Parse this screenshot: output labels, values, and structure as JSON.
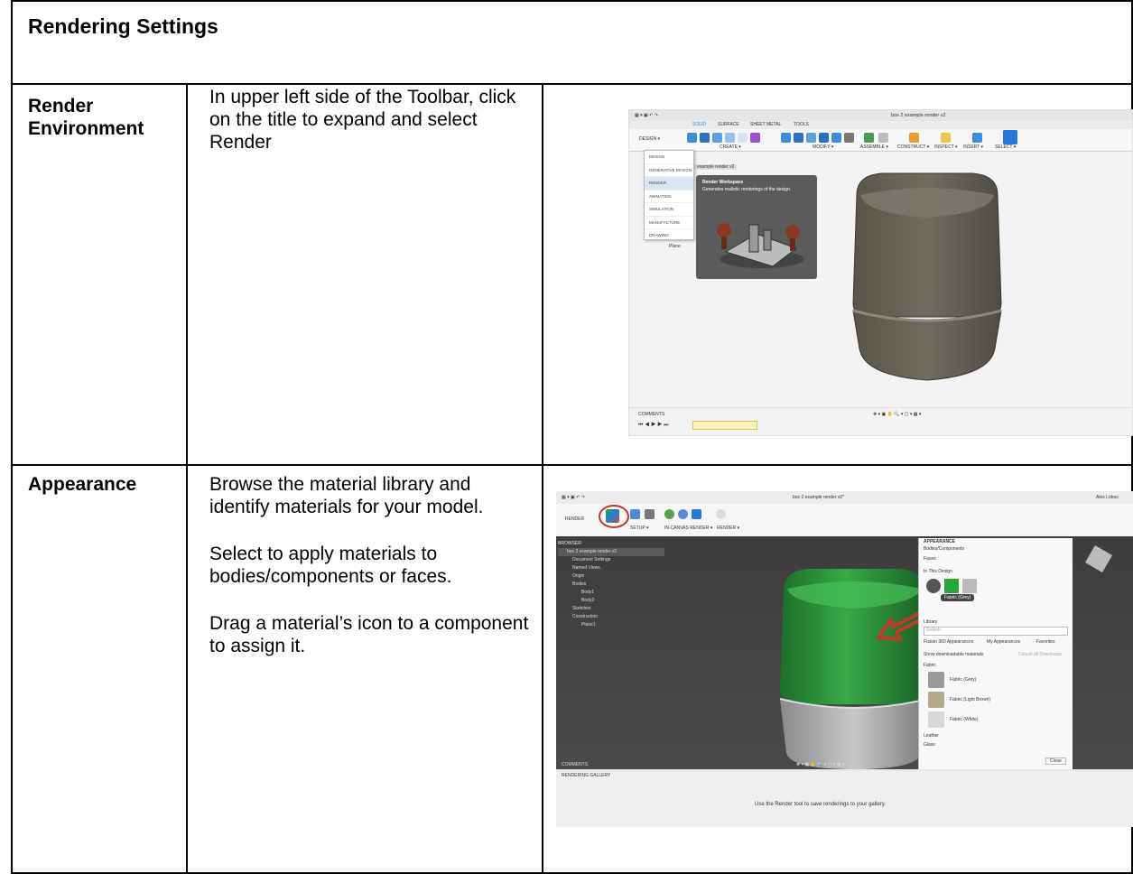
{
  "table": {
    "title": "Rendering Settings",
    "rows": [
      {
        "label": "Render Environment",
        "paragraphs": [
          "In upper left side of the Toolbar, click on the title to expand and select Render"
        ]
      },
      {
        "label": "Appearance",
        "paragraphs": [
          "Browse the material library and identify materials for your model.",
          "Select to apply materials to bodies/components or faces.",
          "Drag a material’s icon to a component to assign it."
        ]
      }
    ]
  },
  "shot1": {
    "window_title": "box 2 example render v2",
    "tabs": [
      "SOLID",
      "SURFACE",
      "SHEET METAL",
      "TOOLS"
    ],
    "workspace_button": "DESIGN ▾",
    "toolbar_groups": [
      "CREATE ▾",
      "MODIFY ▾",
      "ASSEMBLE ▾",
      "CONSTRUCT ▾",
      "INSPECT ▾",
      "INSERT ▾",
      "SELECT ▾"
    ],
    "menu_items": [
      "DESIGN",
      "GENERATIVE DESIGN",
      "RENDER",
      "ANIMATION",
      "SIMULATION",
      "MANUFACTURE",
      "DRAWING"
    ],
    "tooltip_title": "Render Workspace",
    "tooltip_text": "Generates realistic renderings of the design.",
    "doc_tab": "example render v2",
    "plane_label": "Plane",
    "comments": "COMMENTS"
  },
  "shot2": {
    "window_title": "box 2 example render v2*",
    "user": "Alex Lobos",
    "workspace_button": "RENDER",
    "toolbar_groups": [
      "SETUP ▾",
      "IN-CANVAS RENDER ▾",
      "RENDER ▾"
    ],
    "browser_title": "BROWSER",
    "browser_items": [
      "box 2 example render v2",
      "Document Settings",
      "Named Views",
      "Origin",
      "Bodies",
      "Body1",
      "Body2",
      "Sketches",
      "Construction",
      "Plane1"
    ],
    "appearance_panel": {
      "title": "APPEARANCE",
      "apply_to": "Bodies/Components",
      "faces": "Faces",
      "in_design": "In This Design",
      "tooltip": "Fabric (Grey)",
      "library": "Library",
      "search_placeholder": "Search",
      "sources": [
        "Fusion 360 Appearances",
        "My Appearances",
        "Favorites"
      ],
      "show_downloadable": "Show downloadable materials",
      "cancel_downloads": "Cancel all Downloads",
      "folder": "Fabric",
      "materials": [
        "Fabric (Grey)",
        "Fabric (Light Brown)",
        "Fabric (White)"
      ],
      "more_folders": [
        "Leather",
        "Glass"
      ],
      "close": "Close"
    },
    "comments": "COMMENTS",
    "gallery_title": "RENDERING GALLERY",
    "gallery_hint": "Use the Render tool   to save renderings to your gallery."
  },
  "colors": {
    "accent_blue": "#1f7fd6",
    "arrow_red": "#c0392b",
    "model_green": "#2e9a3c",
    "model_grey": "#7b7a6c"
  }
}
